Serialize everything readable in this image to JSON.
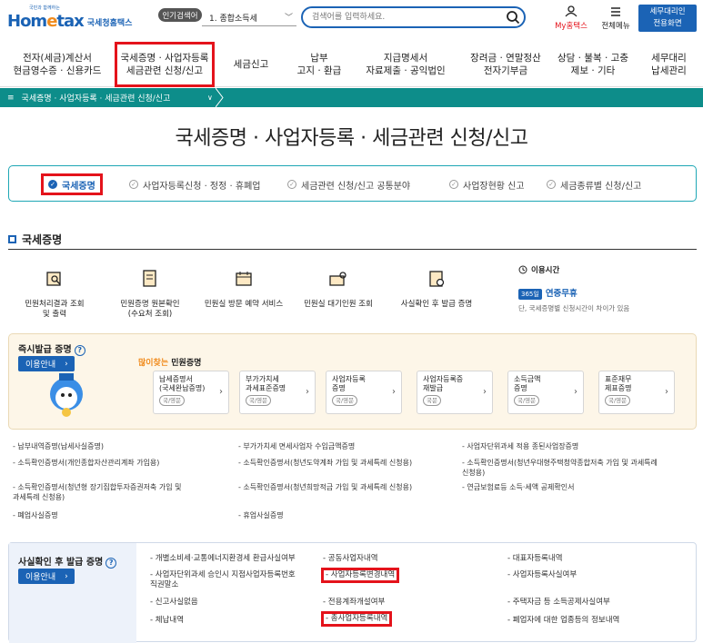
{
  "header": {
    "logo_tiny": "국민과 함께하는",
    "logo_main_a": "Hom",
    "logo_main_b": "e",
    "logo_main_c": "tax",
    "logo_sub": "국세청홈택스",
    "popular_badge": "인기검색어",
    "popular_select": "1. 종합소득세",
    "search_placeholder": "검색어를 입력하세요.",
    "mytax": "My홈택스",
    "allmenu": "전체메뉴",
    "agent_button": "세무대리인\n전용화면"
  },
  "nav": [
    {
      "label": "전자(세금)계산서\n현금영수증 · 신용카드"
    },
    {
      "label": "국세증명 · 사업자등록\n세금관련 신청/신고"
    },
    {
      "label": "세금신고"
    },
    {
      "label": "납부\n고지 · 환급"
    },
    {
      "label": "지급명세서\n자료제출 · 공익법인"
    },
    {
      "label": "장려금 · 연말정산\n전자기부금"
    },
    {
      "label": "상담 · 불복 · 고충\n제보 · 기타"
    },
    {
      "label": "세무대리\n납세관리"
    }
  ],
  "breadcrumb": "국세증명 · 사업자등록 · 세금관련 신청/신고",
  "page_title": "국세증명 · 사업자등록 · 세금관련 신청/신고",
  "tabs": [
    {
      "label": "국세증명"
    },
    {
      "label": "사업자등록신청 · 정정 · 휴폐업"
    },
    {
      "label": "세금관련 신청/신고 공통분야"
    },
    {
      "label": "사업장현황 신고"
    },
    {
      "label": "세금종류별 신청/신고"
    }
  ],
  "section_title": "국세증명",
  "services": [
    {
      "label": "민원처리결과 조회\n및 출력"
    },
    {
      "label": "민원증명 원본확인\n(수요처 조회)"
    },
    {
      "label": "민원실 방문 예약 서비스"
    },
    {
      "label": "민원실 대기인원 조회"
    },
    {
      "label": "사실확인 후 발급 증명"
    }
  ],
  "hours": {
    "title": "이용시간",
    "badge": "365일",
    "allyear": "연중무휴",
    "note": "단, 국세증명별 신청시간이 차이가 있음"
  },
  "instant": {
    "title": "즉시발급 증명",
    "guide": "이용안내",
    "popular_a": "많이찾는",
    "popular_b": " 민원증명",
    "cards": [
      {
        "label": "납세증명서\n(국세완납증명)",
        "tag": "국/영문"
      },
      {
        "label": "부가가치세\n과세표준증명",
        "tag": "국/영문"
      },
      {
        "label": "사업자등록\n증명",
        "tag": "국/영문"
      },
      {
        "label": "사업자등록증\n재발급",
        "tag": "국문"
      },
      {
        "label": "소득금액\n증명",
        "tag": "국/영문"
      },
      {
        "label": "표준재무\n제표증명",
        "tag": "국/영문"
      }
    ]
  },
  "list": [
    "- 납부내역증명(납세사실증명)",
    "- 부가가치세 면세사업자 수입금액증명",
    "- 사업자단위과세 적용 종된사업장증명",
    "- 소득확인증명서(개인종합자산관리계좌 가입용)",
    "- 소득확인증명서(청년도약계좌 가입 및 과세특례 신청용)",
    "- 소득확인증명서(청년우대형주택청약종합저축 가입 및 과세특례\n  신청용)",
    "- 소득확인증명서(청년형 장기집합투자증권저축 가입 및\n  과세특례 신청용)",
    "- 소득확인증명서(청년희망적금 가입 및 과세특례 신청용)",
    "- 연금보험료등 소득·세액 공제확인서",
    "- 폐업사실증명",
    "- 휴업사실증명"
  ],
  "fact": {
    "title": "사실확인 후 발급 증명",
    "guide": "이용안내",
    "items": [
      "- 개별소비세·교통에너지환경세 환급사실여부",
      "- 공동사업자내역",
      "- 대표자등록내역",
      "- 사업자단위과세 승인시 지점사업자등록번호\n  직권말소",
      "- 사업자등록변경내역",
      "- 사업자등록사실여부",
      "- 신고사실없음",
      "- 전용계좌개설여부",
      "- 주택자금 등 소득공제사실여부",
      "- 체납내역",
      "- 총사업자등록내역",
      "- 폐업자에 대한 업종등의 정보내역"
    ]
  },
  "colors": {
    "brand": "#1b63b5",
    "accent_orange": "#f08b1d",
    "teal": "#0d8d8a",
    "highlight": "#e4131b"
  }
}
